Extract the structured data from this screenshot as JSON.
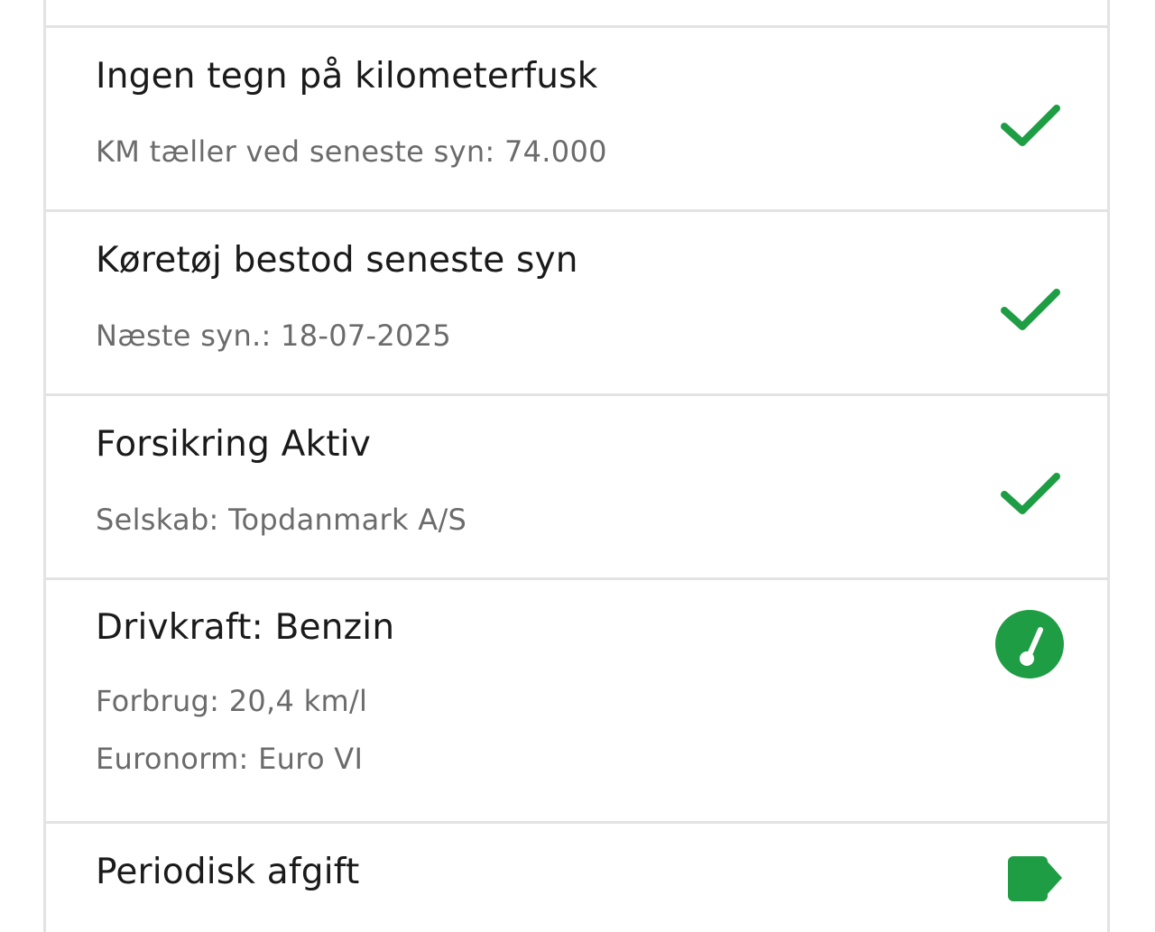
{
  "items": [
    {
      "title": "Ingen tegn på kilometerfusk",
      "lines": [
        "KM tæller ved seneste syn: 74.000"
      ],
      "icon": "check-icon"
    },
    {
      "title": "Køretøj bestod seneste syn",
      "lines": [
        "Næste syn.: 18-07-2025"
      ],
      "icon": "check-icon"
    },
    {
      "title": "Forsikring Aktiv",
      "lines": [
        "Selskab: Topdanmark A/S"
      ],
      "icon": "check-icon"
    },
    {
      "title": "Drivkraft: Benzin",
      "lines": [
        "Forbrug: 20,4 km/l",
        "Euronorm: Euro VI"
      ],
      "icon": "gauge-icon"
    },
    {
      "title": "Periodisk afgift",
      "lines": [],
      "icon": "arrow-icon"
    }
  ],
  "colors": {
    "accent_green": "#1f9d45",
    "divider": "#e3e3e3",
    "title_text": "#1a1a1a",
    "sub_text": "#6b6b6b"
  }
}
